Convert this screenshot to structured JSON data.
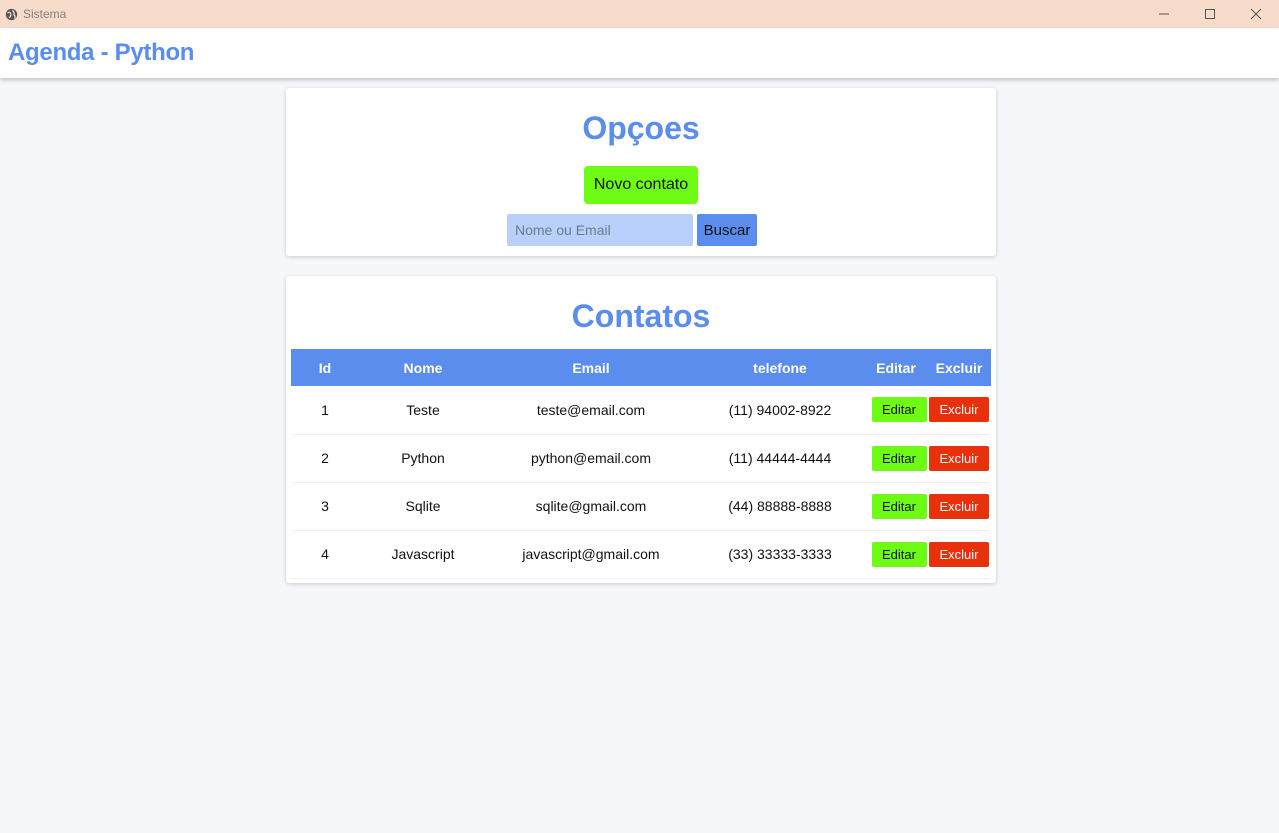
{
  "window": {
    "title": "Sistema",
    "icon": "globe-icon",
    "controls": [
      "minimize-icon",
      "maximize-icon",
      "close-icon"
    ]
  },
  "header": {
    "title": "Agenda - Python"
  },
  "options": {
    "title": "Opçoes",
    "new_contact_label": "Novo contato",
    "search_placeholder": "Nome ou Email",
    "search_value": "",
    "search_button_label": "Buscar"
  },
  "contacts": {
    "title": "Contatos",
    "columns": [
      "Id",
      "Nome",
      "Email",
      "telefone",
      "Editar",
      "Excluir"
    ],
    "rows": [
      {
        "id": "1",
        "name": "Teste",
        "email": "teste@email.com",
        "phone": "(11) 94002-8922",
        "edit_label": "Editar",
        "delete_label": "Excluir"
      },
      {
        "id": "2",
        "name": "Python",
        "email": "python@email.com",
        "phone": "(11) 44444-4444",
        "edit_label": "Editar",
        "delete_label": "Excluir"
      },
      {
        "id": "3",
        "name": "Sqlite",
        "email": "sqlite@gmail.com",
        "phone": "(44) 88888-8888",
        "edit_label": "Editar",
        "delete_label": "Excluir"
      },
      {
        "id": "4",
        "name": "Javascript",
        "email": "javascript@gmail.com",
        "phone": "(33) 33333-3333",
        "edit_label": "Editar",
        "delete_label": "Excluir"
      }
    ]
  },
  "colors": {
    "accent": "#5b8def",
    "titlebar": "#f7dccb",
    "primary_action": "#6efc14",
    "danger": "#e8300c",
    "search_input_bg": "#b8d0fb",
    "page_bg": "#f5f7fb"
  }
}
